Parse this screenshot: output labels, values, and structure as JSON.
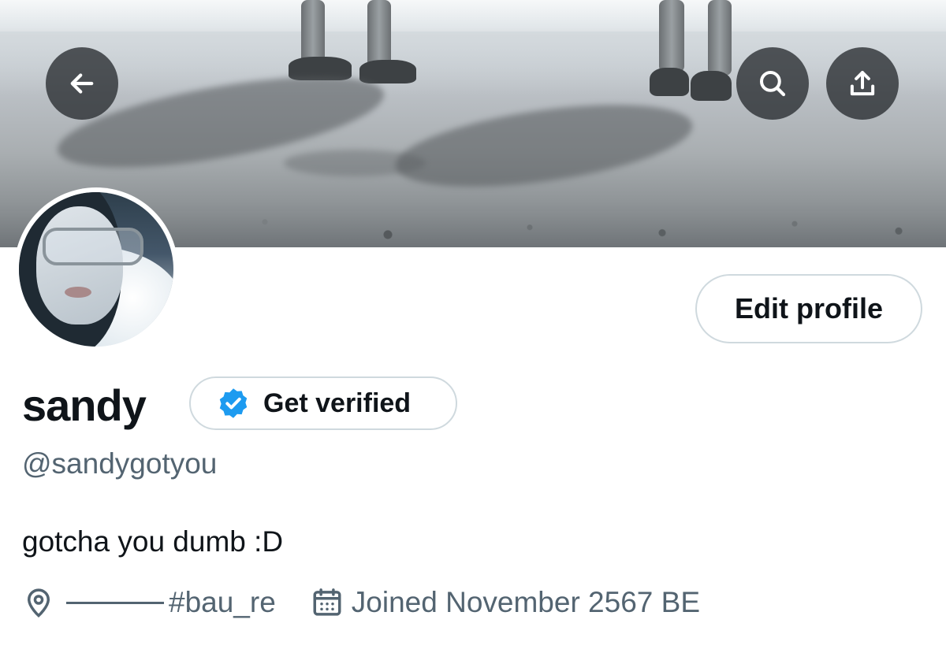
{
  "profile": {
    "name": "sandy",
    "handle": "@sandygotyou",
    "bio": "gotcha you dumb :D",
    "location": "#bau_re",
    "joined": "Joined November 2567 BE"
  },
  "buttons": {
    "edit_profile": "Edit profile",
    "get_verified": "Get verified"
  },
  "icons": {
    "back": "arrow-left",
    "search": "magnifier",
    "share": "upload-arrow",
    "verified": "verified-badge",
    "location": "map-pin",
    "calendar": "calendar"
  },
  "colors": {
    "accent": "#1d9bf0",
    "secondary_text": "#536471",
    "border": "#cfd9de"
  }
}
